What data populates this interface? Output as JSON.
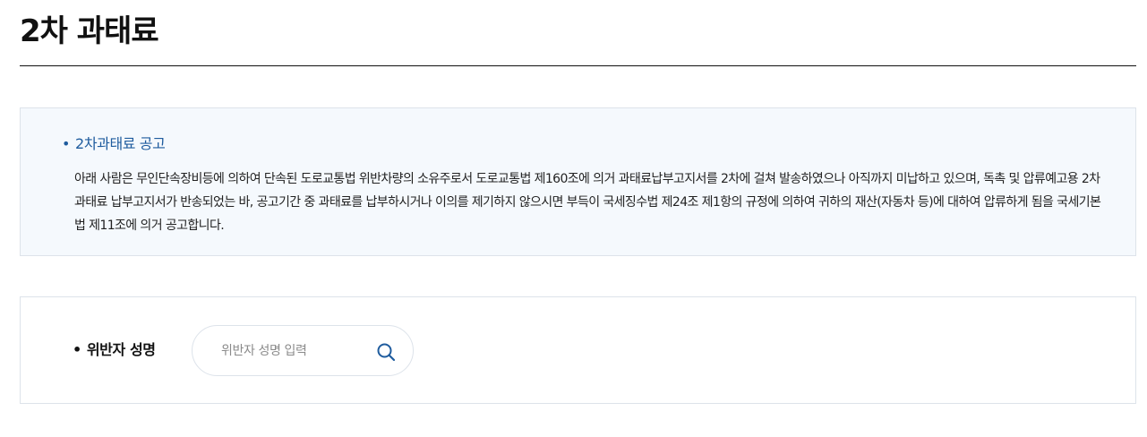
{
  "page": {
    "title": "2차 과태료"
  },
  "notice": {
    "bullet": "•",
    "heading": "2차과태료 공고",
    "body": "아래 사람은 무인단속장비등에 의하여 단속된 도로교통법 위반차량의 소유주로서 도로교통법 제160조에 의거 과태료납부고지서를 2차에 걸쳐 발송하였으나 아직까지 미납하고 있으며, 독촉 및 압류예고용 2차 과태료 납부고지서가 반송되었는 바, 공고기간 중 과태료를 납부하시거나 이의를 제기하지 않으시면 부득이 국세징수법 제24조 제1항의 규정에 의하여 귀하의 재산(자동차 등)에 대하여 압류하게 됨을 국세기본법 제11조에 의거 공고합니다."
  },
  "search": {
    "bullet": "•",
    "label": "위반자 성명",
    "value": "",
    "placeholder": "위반자 성명 입력",
    "icon": "search-icon"
  },
  "colors": {
    "accent": "#1f5c9e",
    "notice_background": "#f5f9fd",
    "border": "#dde3ea",
    "title_rule": "#111111"
  }
}
